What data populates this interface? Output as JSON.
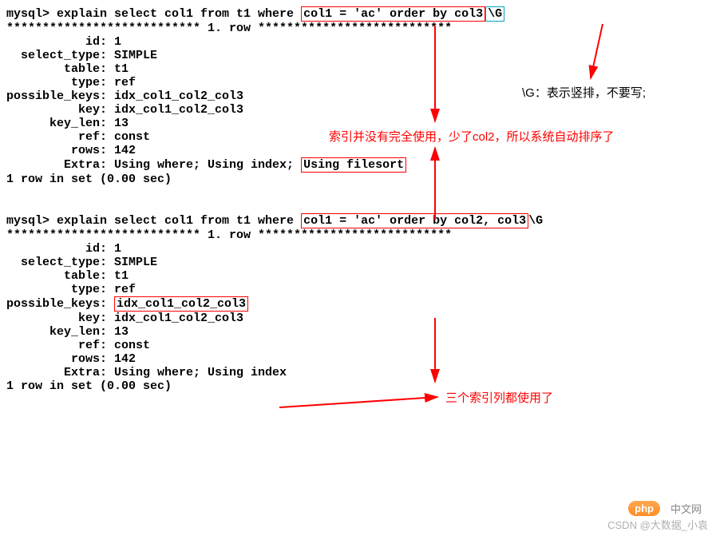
{
  "query1": {
    "prompt": "mysql> explain select col1 from t1 where ",
    "boxed_clause": "col1 = 'ac' order by col3",
    "suffix": "\\G",
    "sep": "*************************** 1. row ***************************",
    "rows": {
      "id": "           id: 1",
      "select_type": "  select_type: SIMPLE",
      "table": "        table: t1",
      "type": "         type: ref",
      "possible_keys": "possible_keys: idx_col1_col2_col3",
      "key": "          key: idx_col1_col2_col3",
      "key_len": "      key_len: 13",
      "ref": "          ref: const",
      "rows_": "         rows: 142",
      "extra_pre": "        Extra: Using where; Using index; ",
      "extra_box": "Using filesort"
    },
    "footer": "1 row in set (0.00 sec)"
  },
  "query2": {
    "prompt": "mysql> explain select col1 from t1 where ",
    "boxed_clause": "col1 = 'ac' order by col2, col3",
    "suffix": "\\G",
    "sep": "*************************** 1. row ***************************",
    "rows": {
      "id": "           id: 1",
      "select_type": "  select_type: SIMPLE",
      "table": "        table: t1",
      "type": "         type: ref",
      "pk_pre": "possible_keys: ",
      "pk_box": "idx_col1_col2_col3",
      "key": "          key: idx_col1_col2_col3",
      "key_len": "      key_len: 13",
      "ref": "          ref: const",
      "rows_": "         rows: 142",
      "extra": "        Extra: Using where; Using index"
    },
    "footer": "1 row in set (0.00 sec)"
  },
  "annotations": {
    "g_explain": "\\G：表示竖排，不要写;",
    "note1": "索引并没有完全使用，少了col2，所以系统自动排序了",
    "note2": "三个索引列都使用了"
  },
  "watermark": "CSDN @大数据_小袁",
  "logo": "php",
  "logo_text": "中文网"
}
